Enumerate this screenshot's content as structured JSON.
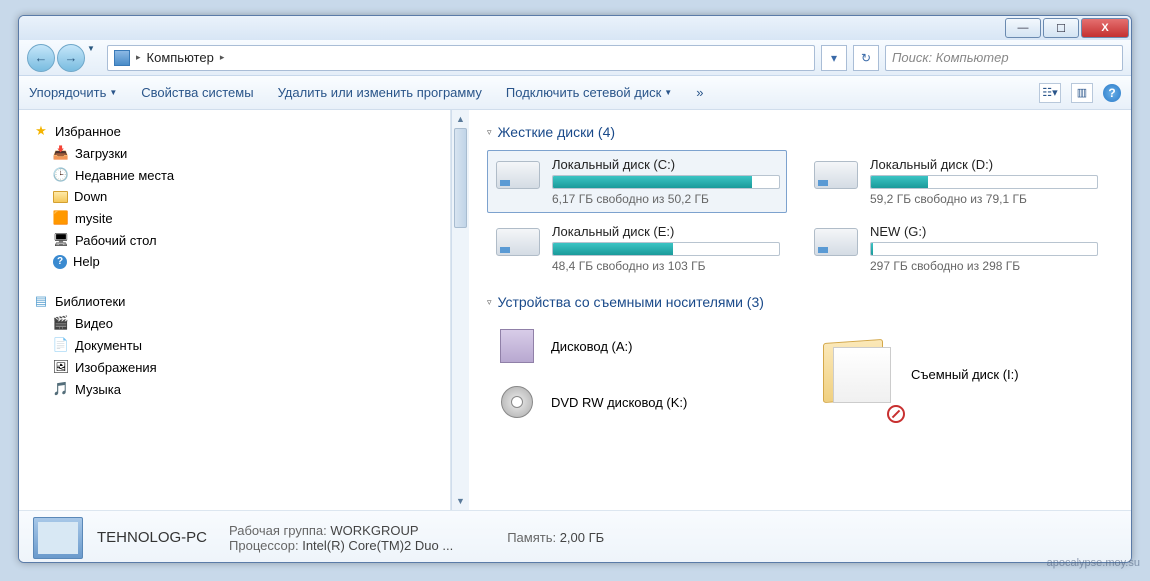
{
  "titlebar": {
    "minimize": "—",
    "maximize": "☐",
    "close": "X"
  },
  "nav": {
    "back": "←",
    "forward": "→",
    "drop": "▼",
    "refresh": "↻"
  },
  "breadcrumb": {
    "root": "",
    "item": "Компьютер",
    "sep": "▸"
  },
  "search": {
    "placeholder": "Поиск: Компьютер"
  },
  "toolbar": {
    "organize": "Упорядочить",
    "sysprops": "Свойства системы",
    "uninstall": "Удалить или изменить программу",
    "netdrive": "Подключить сетевой диск",
    "more": "»",
    "help": "?"
  },
  "sidebar": {
    "fav": "Избранное",
    "fav_items": [
      {
        "label": "Загрузки"
      },
      {
        "label": "Недавние места"
      },
      {
        "label": "Down"
      },
      {
        "label": "mysite"
      },
      {
        "label": "Рабочий стол"
      },
      {
        "label": "Help"
      }
    ],
    "lib": "Библиотеки",
    "lib_items": [
      {
        "label": "Видео"
      },
      {
        "label": "Документы"
      },
      {
        "label": "Изображения"
      },
      {
        "label": "Музыка"
      }
    ]
  },
  "sections": {
    "hdd": "Жесткие диски (4)",
    "removable": "Устройства со съемными носителями (3)"
  },
  "drives": [
    {
      "name": "Локальный диск (C:)",
      "info": "6,17 ГБ свободно из 50,2 ГБ",
      "fill": 88,
      "sel": true
    },
    {
      "name": "Локальный диск (D:)",
      "info": "59,2 ГБ свободно из 79,1 ГБ",
      "fill": 25,
      "sel": false
    },
    {
      "name": "Локальный диск (E:)",
      "info": "48,4 ГБ свободно из 103 ГБ",
      "fill": 53,
      "sel": false
    },
    {
      "name": "NEW (G:)",
      "info": "297 ГБ свободно из 298 ГБ",
      "fill": 1,
      "sel": false
    }
  ],
  "removable": [
    {
      "name": "Дисковод (A:)",
      "kind": "floppy"
    },
    {
      "name": "Съемный диск (I:)",
      "kind": "folder"
    },
    {
      "name": "DVD RW дисковод (K:)",
      "kind": "dvd"
    }
  ],
  "status": {
    "pcname": "TEHNOLOG-PC",
    "wg_lbl": "Рабочая группа:",
    "wg": "WORKGROUP",
    "mem_lbl": "Память:",
    "mem": "2,00 ГБ",
    "cpu_lbl": "Процессор:",
    "cpu": "Intel(R) Core(TM)2 Duo ..."
  },
  "watermark": "apocalypse.moy.su"
}
